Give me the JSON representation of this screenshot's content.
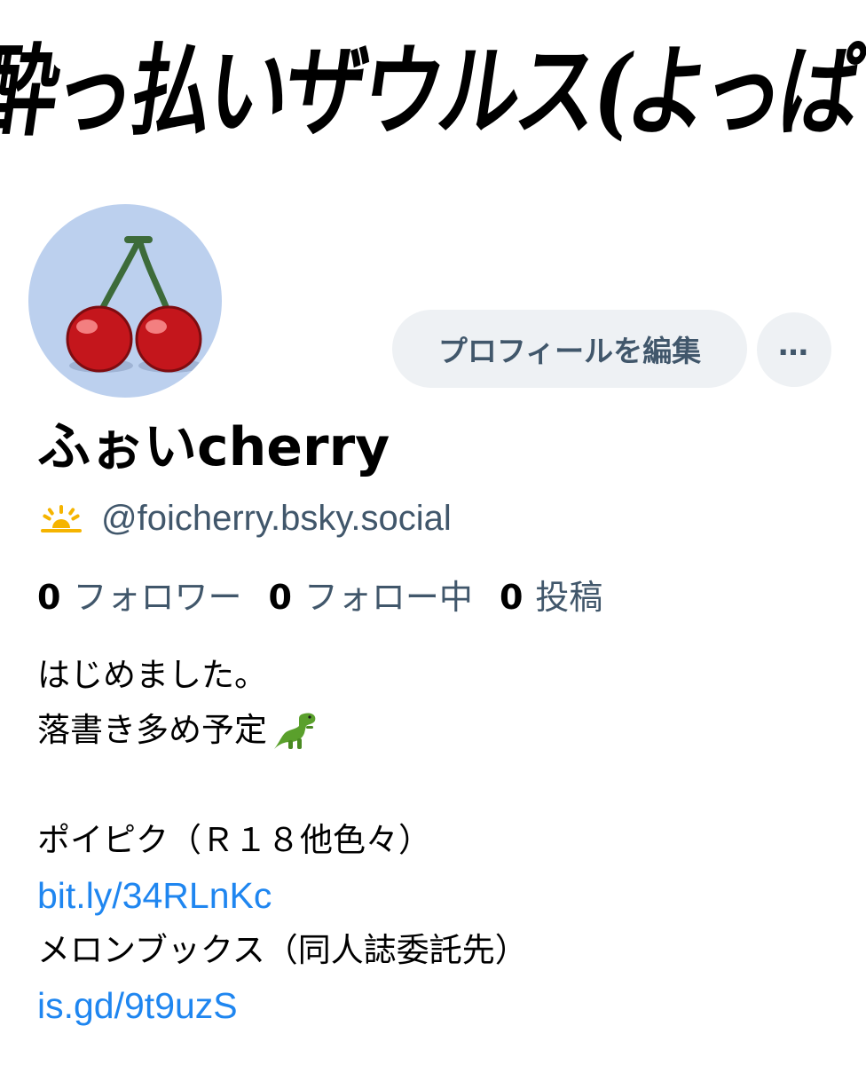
{
  "banner": {
    "text": "酔っ払いザウルス(よっぱらいざうるす)"
  },
  "profile": {
    "display_name": "ふぉいcherry",
    "handle": "@foicherry.bsky.social",
    "handle_icon": "sunrise-icon",
    "avatar_icon": "cherry-icon"
  },
  "actions": {
    "edit_label": "プロフィールを編集",
    "more_label": "…"
  },
  "stats": {
    "followers_count": "0",
    "followers_label": "フォロワー",
    "following_count": "0",
    "following_label": "フォロー中",
    "posts_count": "0",
    "posts_label": "投稿"
  },
  "bio": {
    "line1": "はじめました。",
    "line2": "落書き多め予定",
    "line2_icon": "dinosaur-icon",
    "line4": "ポイピク（Ｒ１８他色々）",
    "link1": "bit.ly/34RLnKc",
    "line6": "メロンブックス（同人誌委託先）",
    "link2": "is.gd/9t9uzS"
  },
  "colors": {
    "secondary_text": "#41576b",
    "link": "#1f86f0",
    "button_bg": "#eef1f4",
    "avatar_bg": "#bcd0ee"
  }
}
